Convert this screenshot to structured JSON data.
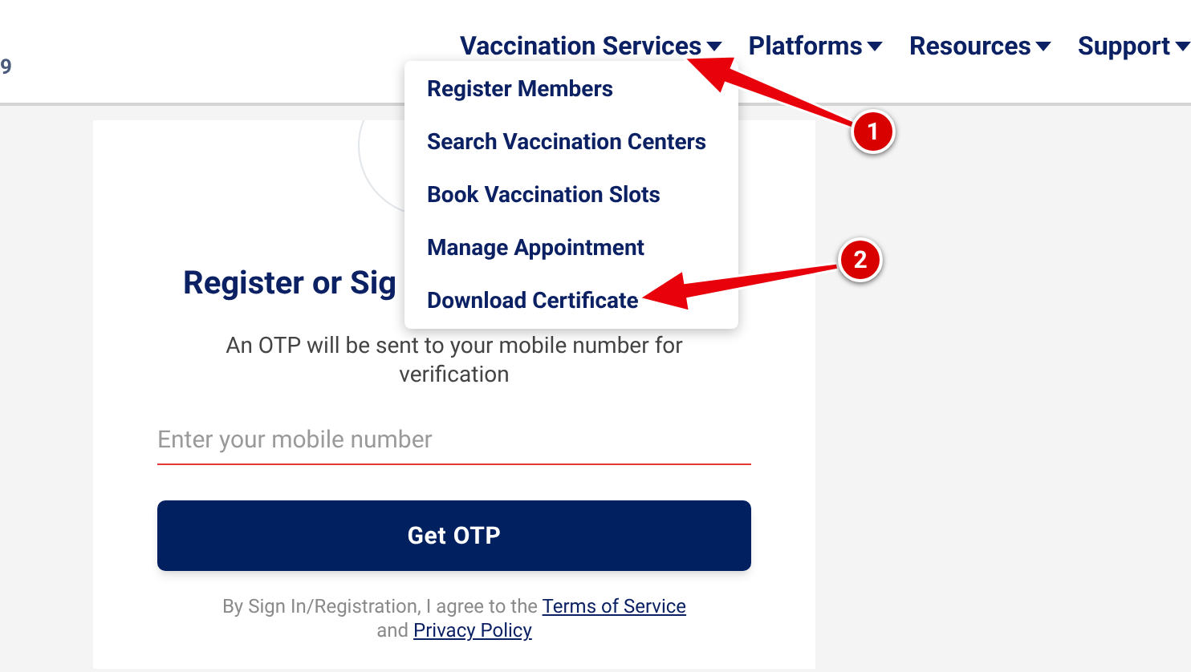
{
  "header": {
    "logo_fragment": "9",
    "nav": [
      {
        "label": "Vaccination Services",
        "open_menu": [
          "Register Members",
          "Search Vaccination Centers",
          "Book Vaccination Slots",
          "Manage Appointment",
          "Download Certificate"
        ]
      },
      {
        "label": "Platforms"
      },
      {
        "label": "Resources"
      },
      {
        "label": "Support"
      }
    ]
  },
  "login": {
    "title": "Register or Sig",
    "subtitle": "An OTP will be sent to your mobile number for verification",
    "phone_field": {
      "placeholder": "Enter your mobile number"
    },
    "button": "Get OTP",
    "terms": {
      "before": "By Sign In/Registration, I agree to the",
      "link_1": "Terms of Service",
      "middle": "and",
      "link_2": "Privacy Policy"
    }
  },
  "annotations": [
    {
      "number": "1"
    },
    {
      "number": "2"
    }
  ]
}
